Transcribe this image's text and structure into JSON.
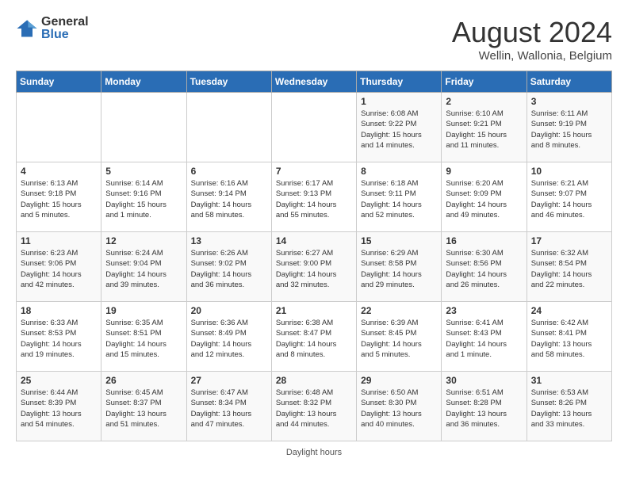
{
  "header": {
    "logo_general": "General",
    "logo_blue": "Blue",
    "month_title": "August 2024",
    "location": "Wellin, Wallonia, Belgium"
  },
  "days_of_week": [
    "Sunday",
    "Monday",
    "Tuesday",
    "Wednesday",
    "Thursday",
    "Friday",
    "Saturday"
  ],
  "weeks": [
    [
      {
        "day": "",
        "info": ""
      },
      {
        "day": "",
        "info": ""
      },
      {
        "day": "",
        "info": ""
      },
      {
        "day": "",
        "info": ""
      },
      {
        "day": "1",
        "info": "Sunrise: 6:08 AM\nSunset: 9:22 PM\nDaylight: 15 hours\nand 14 minutes."
      },
      {
        "day": "2",
        "info": "Sunrise: 6:10 AM\nSunset: 9:21 PM\nDaylight: 15 hours\nand 11 minutes."
      },
      {
        "day": "3",
        "info": "Sunrise: 6:11 AM\nSunset: 9:19 PM\nDaylight: 15 hours\nand 8 minutes."
      }
    ],
    [
      {
        "day": "4",
        "info": "Sunrise: 6:13 AM\nSunset: 9:18 PM\nDaylight: 15 hours\nand 5 minutes."
      },
      {
        "day": "5",
        "info": "Sunrise: 6:14 AM\nSunset: 9:16 PM\nDaylight: 15 hours\nand 1 minute."
      },
      {
        "day": "6",
        "info": "Sunrise: 6:16 AM\nSunset: 9:14 PM\nDaylight: 14 hours\nand 58 minutes."
      },
      {
        "day": "7",
        "info": "Sunrise: 6:17 AM\nSunset: 9:13 PM\nDaylight: 14 hours\nand 55 minutes."
      },
      {
        "day": "8",
        "info": "Sunrise: 6:18 AM\nSunset: 9:11 PM\nDaylight: 14 hours\nand 52 minutes."
      },
      {
        "day": "9",
        "info": "Sunrise: 6:20 AM\nSunset: 9:09 PM\nDaylight: 14 hours\nand 49 minutes."
      },
      {
        "day": "10",
        "info": "Sunrise: 6:21 AM\nSunset: 9:07 PM\nDaylight: 14 hours\nand 46 minutes."
      }
    ],
    [
      {
        "day": "11",
        "info": "Sunrise: 6:23 AM\nSunset: 9:06 PM\nDaylight: 14 hours\nand 42 minutes."
      },
      {
        "day": "12",
        "info": "Sunrise: 6:24 AM\nSunset: 9:04 PM\nDaylight: 14 hours\nand 39 minutes."
      },
      {
        "day": "13",
        "info": "Sunrise: 6:26 AM\nSunset: 9:02 PM\nDaylight: 14 hours\nand 36 minutes."
      },
      {
        "day": "14",
        "info": "Sunrise: 6:27 AM\nSunset: 9:00 PM\nDaylight: 14 hours\nand 32 minutes."
      },
      {
        "day": "15",
        "info": "Sunrise: 6:29 AM\nSunset: 8:58 PM\nDaylight: 14 hours\nand 29 minutes."
      },
      {
        "day": "16",
        "info": "Sunrise: 6:30 AM\nSunset: 8:56 PM\nDaylight: 14 hours\nand 26 minutes."
      },
      {
        "day": "17",
        "info": "Sunrise: 6:32 AM\nSunset: 8:54 PM\nDaylight: 14 hours\nand 22 minutes."
      }
    ],
    [
      {
        "day": "18",
        "info": "Sunrise: 6:33 AM\nSunset: 8:53 PM\nDaylight: 14 hours\nand 19 minutes."
      },
      {
        "day": "19",
        "info": "Sunrise: 6:35 AM\nSunset: 8:51 PM\nDaylight: 14 hours\nand 15 minutes."
      },
      {
        "day": "20",
        "info": "Sunrise: 6:36 AM\nSunset: 8:49 PM\nDaylight: 14 hours\nand 12 minutes."
      },
      {
        "day": "21",
        "info": "Sunrise: 6:38 AM\nSunset: 8:47 PM\nDaylight: 14 hours\nand 8 minutes."
      },
      {
        "day": "22",
        "info": "Sunrise: 6:39 AM\nSunset: 8:45 PM\nDaylight: 14 hours\nand 5 minutes."
      },
      {
        "day": "23",
        "info": "Sunrise: 6:41 AM\nSunset: 8:43 PM\nDaylight: 14 hours\nand 1 minute."
      },
      {
        "day": "24",
        "info": "Sunrise: 6:42 AM\nSunset: 8:41 PM\nDaylight: 13 hours\nand 58 minutes."
      }
    ],
    [
      {
        "day": "25",
        "info": "Sunrise: 6:44 AM\nSunset: 8:39 PM\nDaylight: 13 hours\nand 54 minutes."
      },
      {
        "day": "26",
        "info": "Sunrise: 6:45 AM\nSunset: 8:37 PM\nDaylight: 13 hours\nand 51 minutes."
      },
      {
        "day": "27",
        "info": "Sunrise: 6:47 AM\nSunset: 8:34 PM\nDaylight: 13 hours\nand 47 minutes."
      },
      {
        "day": "28",
        "info": "Sunrise: 6:48 AM\nSunset: 8:32 PM\nDaylight: 13 hours\nand 44 minutes."
      },
      {
        "day": "29",
        "info": "Sunrise: 6:50 AM\nSunset: 8:30 PM\nDaylight: 13 hours\nand 40 minutes."
      },
      {
        "day": "30",
        "info": "Sunrise: 6:51 AM\nSunset: 8:28 PM\nDaylight: 13 hours\nand 36 minutes."
      },
      {
        "day": "31",
        "info": "Sunrise: 6:53 AM\nSunset: 8:26 PM\nDaylight: 13 hours\nand 33 minutes."
      }
    ]
  ],
  "footer": "Daylight hours"
}
